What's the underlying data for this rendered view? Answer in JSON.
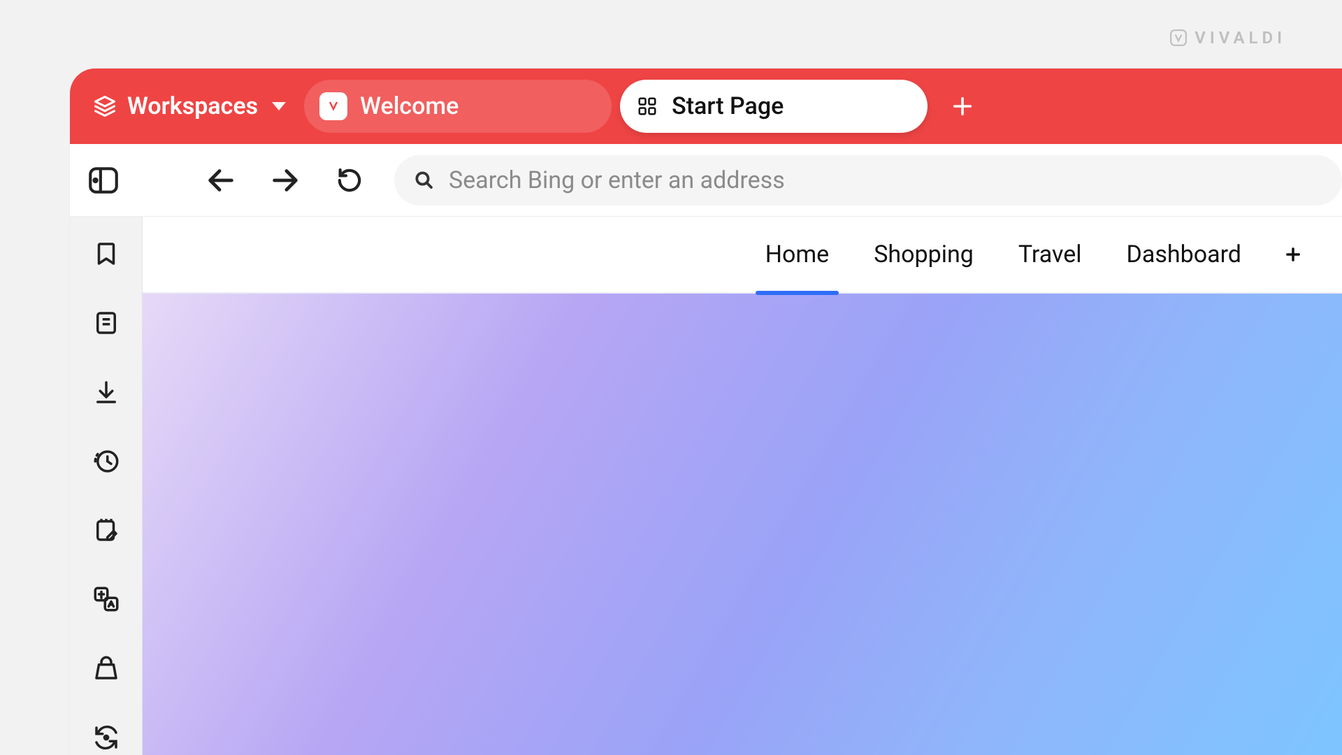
{
  "brand": {
    "name": "VIVALDI"
  },
  "tabstrip": {
    "workspaces_label": "Workspaces",
    "tabs": [
      {
        "title": "Welcome",
        "active": false
      },
      {
        "title": "Start Page",
        "active": true
      }
    ]
  },
  "navbar": {
    "address_placeholder": "Search Bing or enter an address"
  },
  "speeddial": {
    "items": [
      "Home",
      "Shopping",
      "Travel",
      "Dashboard"
    ],
    "active_index": 0
  },
  "sidebar": {
    "panels": [
      "bookmarks",
      "reading-list",
      "downloads",
      "history",
      "notes",
      "translate",
      "sessions",
      "sync"
    ]
  }
}
